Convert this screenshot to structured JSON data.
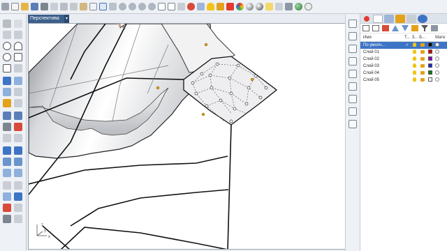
{
  "viewport": {
    "tab_label": "Перспектива",
    "tab_menu_icon": "triangle-down-icon",
    "axes": {
      "z": "z",
      "x": "x",
      "y": "y"
    }
  },
  "layers": {
    "headers": {
      "name": "Имя",
      "t": "Т...",
      "z": "З...",
      "b": "Б...",
      "material": "Мате"
    },
    "rows": [
      {
        "name": "По умолч...",
        "color": "#000000",
        "current": true
      },
      {
        "name": "Слой 01",
        "color": "#d40000"
      },
      {
        "name": "Слой 02",
        "color": "#8a00c8"
      },
      {
        "name": "Слой 03",
        "color": "#1d28c8"
      },
      {
        "name": "Слой 04",
        "color": "#107a10"
      },
      {
        "name": "Слой 05",
        "color": "#ffffff"
      }
    ]
  },
  "colors": {
    "accent": "#3d74c5",
    "tab_bg": "#3d5f8c"
  }
}
